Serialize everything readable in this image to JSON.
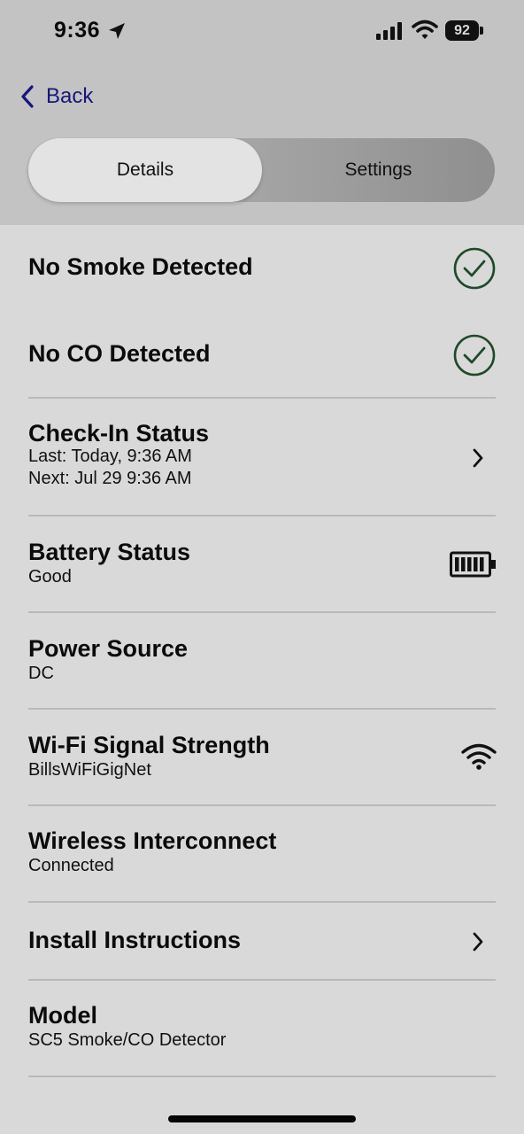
{
  "status_bar": {
    "time": "9:36",
    "battery": "92"
  },
  "nav": {
    "back_label": "Back"
  },
  "tabs": [
    {
      "label": "Details",
      "selected": true
    },
    {
      "label": "Settings",
      "selected": false
    }
  ],
  "items": [
    {
      "title": "No Smoke Detected",
      "icon": "check-circle-icon"
    },
    {
      "title": "No CO Detected",
      "icon": "check-circle-icon"
    },
    {
      "title": "Check-In Status",
      "sub1": "Last: Today, 9:36 AM",
      "sub2": "Next: Jul 29 9:36 AM",
      "icon": "chevron-right-icon"
    },
    {
      "title": "Battery Status",
      "sub1": "Good",
      "icon": "battery-full-icon"
    },
    {
      "title": "Power Source",
      "sub1": "DC"
    },
    {
      "title": "Wi-Fi Signal Strength",
      "sub1": "BillsWiFiGigNet",
      "icon": "wifi-signal-icon"
    },
    {
      "title": "Wireless Interconnect",
      "sub1": "Connected"
    },
    {
      "title": "Install Instructions",
      "icon": "chevron-right-icon"
    },
    {
      "title": "Model",
      "sub1": "SC5 Smoke/CO Detector"
    }
  ],
  "colors": {
    "accent_green": "#1f4a2a",
    "back_link": "#17177a",
    "header_bg": "#c3c3c3",
    "content_bg": "#d9d9d9"
  }
}
